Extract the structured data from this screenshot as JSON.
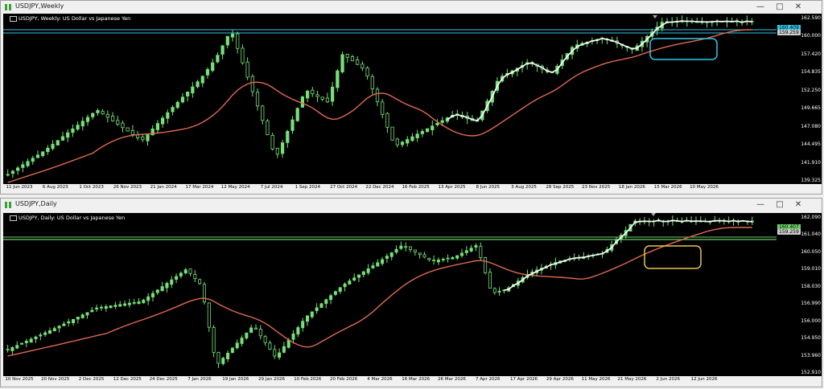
{
  "windows": [
    {
      "id": "weekly",
      "title": "USDJPY,Weekly",
      "chart_label": "USDJPY, Weekly:  US Dollar vs Japanese Yen",
      "price_labels": [
        "162.590",
        "160.000",
        "157.420",
        "154.835",
        "152.250",
        "149.665",
        "147.080",
        "144.495",
        "141.910",
        "139.325"
      ],
      "current_tags": [
        "160.409",
        "159.259"
      ],
      "time_labels": [
        "11 Jun 2023",
        "6 Aug 2023",
        "1 Oct 2023",
        "26 Nov 2023",
        "21 Jan 2024",
        "17 Mar 2024",
        "12 May 2024",
        "7 Jul 2024",
        "1 Sep 2024",
        "27 Oct 2024",
        "22 Dec 2024",
        "16 Feb 2025",
        "13 Apr 2025",
        "8 Jun 2025",
        "3 Aug 2025",
        "28 Sep 2025",
        "23 Nov 2025",
        "18 Jan 2026",
        "15 Mar 2026",
        "10 May 2026"
      ],
      "highlight_color": "#35c7e6"
    },
    {
      "id": "daily",
      "title": "USDJPY,Daily",
      "chart_label": "USDJPY, Daily:  US Dollar vs Japanese Yen",
      "price_labels": [
        "162.090",
        "161.040",
        "160.050",
        "159.010",
        "158.030",
        "156.990",
        "156.000",
        "154.950",
        "153.960",
        "152.910"
      ],
      "current_tags": [
        "160.407",
        "159.259"
      ],
      "time_labels": [
        "10 Nov 2025",
        "20 Nov 2025",
        "2 Dec 2025",
        "12 Dec 2025",
        "24 Dec 2025",
        "7 Jan 2026",
        "19 Jan 2026",
        "29 Jan 2026",
        "10 Feb 2026",
        "20 Feb 2026",
        "4 Mar 2026",
        "16 Mar 2026",
        "26 Mar 2026",
        "7 Apr 2026",
        "17 Apr 2026",
        "29 Apr 2026",
        "11 May 2026",
        "21 May 2026",
        "2 Jun 2026",
        "12 Jun 2026"
      ],
      "highlight_color": "#e8c54a"
    }
  ],
  "buttons": {
    "minimize": "—",
    "maximize": "□",
    "close": "✕"
  },
  "colors": {
    "bull": "#77e07a",
    "ma": "#e06a4f",
    "swing": "#ffffff",
    "hline_blue": "#35c7e6",
    "hline_green": "#6fd06a"
  }
}
